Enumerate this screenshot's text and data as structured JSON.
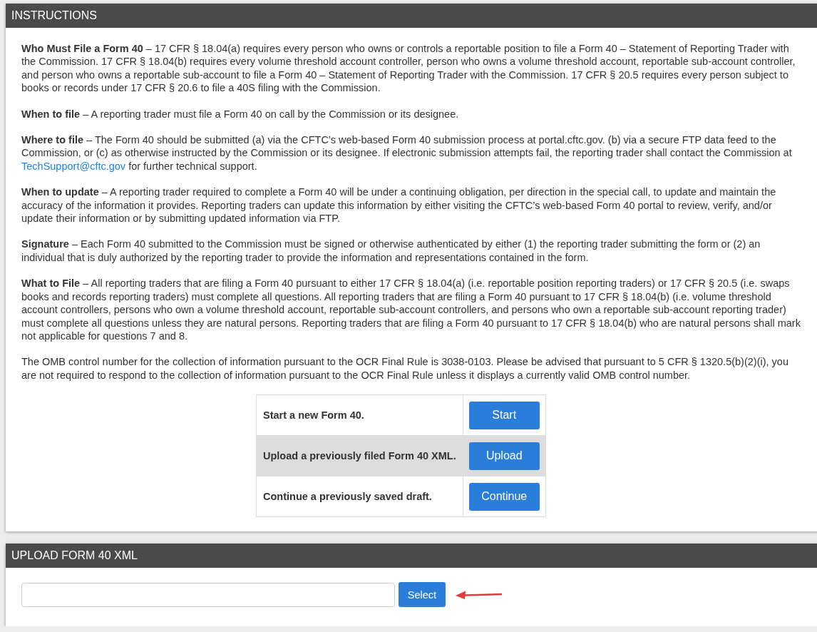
{
  "instructions": {
    "title": "INSTRUCTIONS",
    "paragraphs": [
      {
        "text": "**Who Must File a Form 40** – 17 CFR § 18.04(a) requires every person who owns or controls a reportable position to file a Form 40 – Statement of Reporting Trader with the Commission. 17 CFR § 18.04(b) requires every volume threshold account controller, person who owns a volume threshold account, reportable sub-account controller, and person who owns a reportable sub-account to file a Form 40 – Statement of Reporting Trader with the Commission. 17 CFR § 20.5 requires every person subject to books or records under 17 CFR § 20.6 to file a 40S filing with the Commission."
      },
      {
        "text": "**When to file** – A reporting trader must file a Form 40 on call by the Commission or its designee."
      },
      {
        "text": "**Where to file** – The Form 40 should be submitted (a) via the CFTC’s web-based Form 40 submission process at portal.cftc.gov. (b) via a secure FTP data feed to the Commission, or (c) as otherwise instructed by the Commission or its designee. If electronic submission attempts fail, the reporting trader shall contact the Commission at",
        "link": "TechSupport@cftc.gov",
        "after": "for further technical support."
      },
      {
        "text": "**When to update** – A reporting trader required to complete a Form 40 will be under a continuing obligation, per direction in the special call, to update and maintain the accuracy of the information it provides. Reporting traders can update this information by either visiting the CFTC’s web-based Form 40 portal to review, verify, and/or update their information or by submitting updated information via FTP."
      },
      {
        "text": "**Signature** – Each Form 40 submitted to the Commission must be signed or otherwise authenticated by either (1) the reporting trader submitting the form or (2) an individual that is duly authorized by the reporting trader to provide the information and representations contained in the form."
      },
      {
        "text": "**What to File** – All reporting traders that are filing a Form 40 pursuant to either 17 CFR § 18.04(a) (i.e. reportable position reporting traders) or 17 CFR § 20.5 (i.e. swaps books and records reporting traders) must complete all questions. All reporting traders that are filing a Form 40 pursuant to 17 CFR § 18.04(b) (i.e. volume threshold account controllers, persons who own a volume threshold account, reportable sub-account controllers, and persons who own a reportable sub-account reporting trader) must complete all questions unless they are natural persons. Reporting traders that are filing a Form 40 pursuant to 17 CFR § 18.04(b) who are natural persons shall mark not applicable for questions 7 and 8."
      },
      {
        "text": "The OMB control number for the collection of information pursuant to the OCR Final Rule is 3038-0103. Please be advised that pursuant to 5 CFR § 1320.5(b)(2)(i), you are not required to respond to the collection of information pursuant to the OCR Final Rule unless it displays a currently valid OMB control number."
      }
    ],
    "actions": [
      {
        "label": "Start a new Form 40.",
        "button": "Start",
        "highlighted": false
      },
      {
        "label": "Upload a previously filed Form 40 XML.",
        "button": "Upload",
        "highlighted": true
      },
      {
        "label": "Continue a previously saved draft.",
        "button": "Continue",
        "highlighted": false
      }
    ]
  },
  "upload": {
    "title": "UPLOAD FORM 40 XML",
    "button": "Select"
  }
}
